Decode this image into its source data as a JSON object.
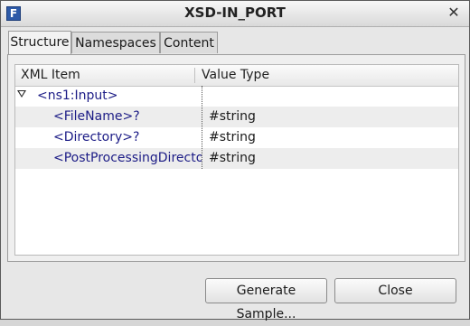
{
  "window": {
    "title": "XSD-IN_PORT",
    "app_icon": "F"
  },
  "tabs": [
    {
      "label": "Structure",
      "active": true
    },
    {
      "label": "Namespaces",
      "active": false
    },
    {
      "label": "Content",
      "active": false
    }
  ],
  "tree": {
    "columns": {
      "item": "XML Item",
      "type": "Value Type"
    },
    "rows": [
      {
        "item": "<ns1:Input>",
        "type": "",
        "expanded": true
      },
      {
        "item": "<FileName>?",
        "type": "#string"
      },
      {
        "item": "<Directory>?",
        "type": "#string"
      },
      {
        "item": "<PostProcessingDirecto",
        "type": "#string"
      }
    ]
  },
  "buttons": {
    "generate": "Generate Sample...",
    "close": "Close"
  },
  "icons": {
    "app": "application-icon",
    "close": "close-icon",
    "expander": "triangle-down-icon"
  }
}
